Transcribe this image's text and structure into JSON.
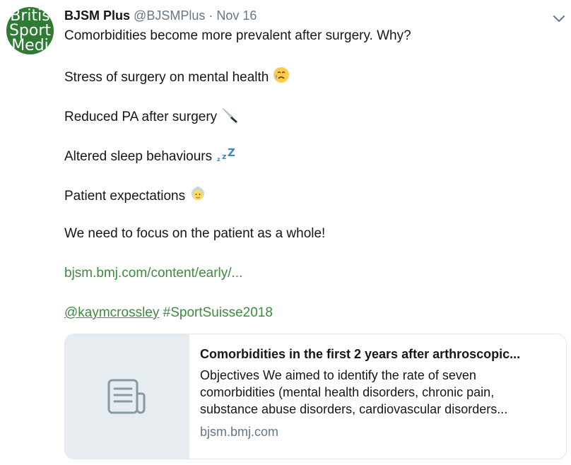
{
  "tweet": {
    "avatar_lines": [
      "Britis",
      "Sport",
      "Medi"
    ],
    "author_name": "BJSM Plus",
    "author_handle": "@BJSMPlus",
    "separator": "·",
    "date": "Nov 16",
    "lines": {
      "intro": "Comorbidities become more prevalent after surgery. Why?",
      "stress": "Stress of surgery on mental health",
      "pa": "Reduced PA after surgery",
      "sleep": "Altered sleep behaviours",
      "expect": "Patient expectations",
      "focus": "We need to focus on the patient as a whole!"
    },
    "url": "bjsm.bmj.com/content/early/...",
    "mention": "@kaymcrossley",
    "hashtag": "#SportSuisse2018",
    "emojis": [
      "sad-sweat-face-emoji",
      "knife-emoji",
      "sleeping-zzz-emoji",
      "older-woman-emoji"
    ]
  },
  "card": {
    "title": "Comorbidities in the first 2 years after arthroscopic...",
    "desc_lines": [
      "Objectives We aimed to identify the rate of seven",
      "comorbidities (mental health disorders, chronic pain,",
      "substance abuse disorders, cardiovascular disorders..."
    ],
    "domain": "bjsm.bmj.com",
    "thumb_icon": "document-icon"
  },
  "colors": {
    "link": "#3d8b3d",
    "muted": "#657786",
    "avatar_bg": "#2f7a34"
  }
}
